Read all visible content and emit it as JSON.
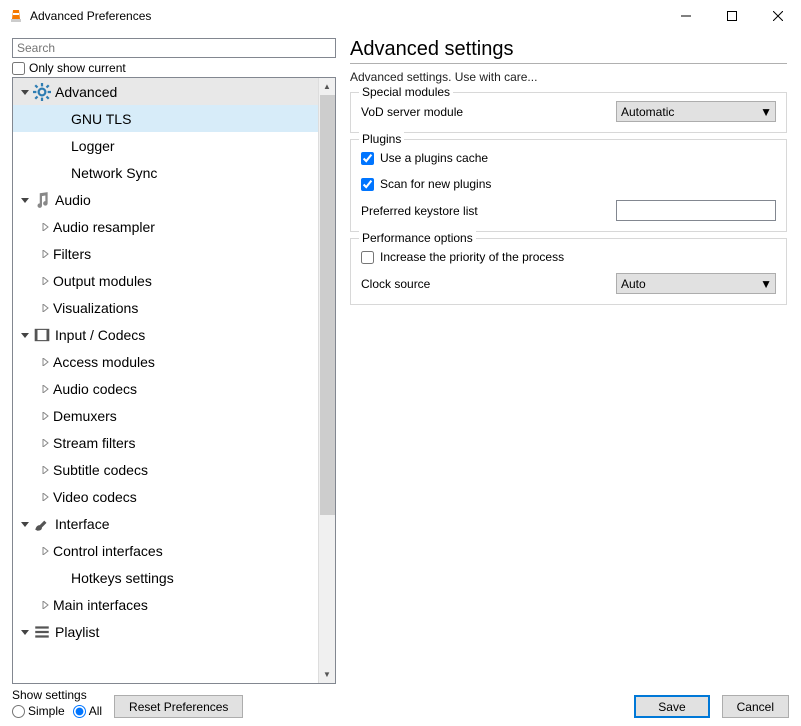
{
  "window": {
    "title": "Advanced Preferences"
  },
  "search": {
    "placeholder": "Search"
  },
  "only_show_label": "Only show current",
  "tree": {
    "advanced": {
      "label": "Advanced",
      "children": {
        "gnutls": "GNU TLS",
        "logger": "Logger",
        "netsync": "Network Sync"
      }
    },
    "audio": {
      "label": "Audio",
      "children": {
        "resampler": "Audio resampler",
        "filters": "Filters",
        "output": "Output modules",
        "viz": "Visualizations"
      }
    },
    "input": {
      "label": "Input / Codecs",
      "children": {
        "access": "Access modules",
        "audiocodecs": "Audio codecs",
        "demux": "Demuxers",
        "streamfilt": "Stream filters",
        "subcodecs": "Subtitle codecs",
        "vidcodecs": "Video codecs"
      }
    },
    "interface": {
      "label": "Interface",
      "children": {
        "control": "Control interfaces",
        "hotkeys": "Hotkeys settings",
        "main": "Main interfaces"
      }
    },
    "playlist": {
      "label": "Playlist"
    }
  },
  "right": {
    "heading": "Advanced settings",
    "subtext": "Advanced settings. Use with care...",
    "special": {
      "title": "Special modules",
      "vod_label": "VoD server module",
      "vod_value": "Automatic"
    },
    "plugins": {
      "title": "Plugins",
      "cache": "Use a plugins cache",
      "scan": "Scan for new plugins",
      "keystore_label": "Preferred keystore list",
      "keystore_value": ""
    },
    "perf": {
      "title": "Performance options",
      "priority": "Increase the priority of the process",
      "clock_label": "Clock source",
      "clock_value": "Auto"
    }
  },
  "footer": {
    "show_settings": "Show settings",
    "simple": "Simple",
    "all": "All",
    "reset": "Reset Preferences",
    "save": "Save",
    "cancel": "Cancel"
  }
}
